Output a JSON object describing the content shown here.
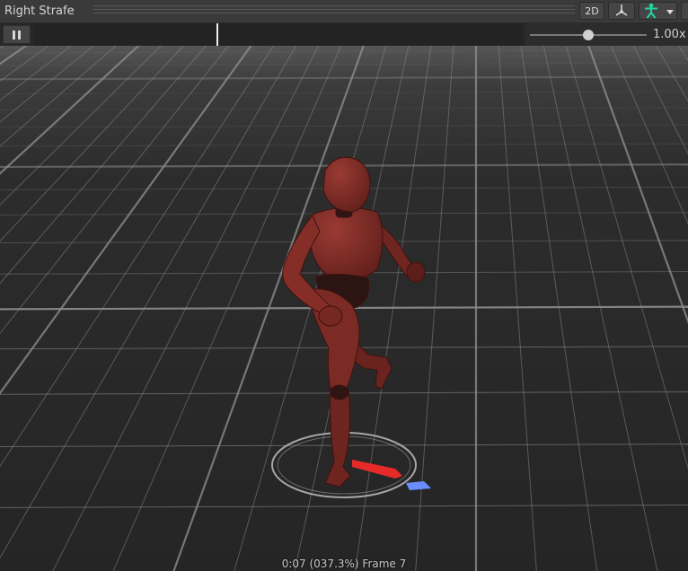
{
  "window": {
    "title": "Right Strafe"
  },
  "toolbar": {
    "view_2d_label": "2D",
    "pivot_icon": "pivot-icon",
    "avatar_icon": "avatar-icon",
    "dropdown_icon": "chevron-down-icon"
  },
  "transport": {
    "pause_icon": "pause-icon",
    "playhead_position": 0.373,
    "speed": {
      "slider_fraction": 0.5,
      "value_text": "1.00x"
    }
  },
  "viewport": {
    "subject": "character-model",
    "status_text": "0:07 (037.3%) Frame 7"
  },
  "colors": {
    "floor": "#262626",
    "grid_line": "#8c8c8c",
    "character": "#7c2a24",
    "gizmo_red": "#e62a2a",
    "gizmo_blue": "#6a8cff"
  }
}
